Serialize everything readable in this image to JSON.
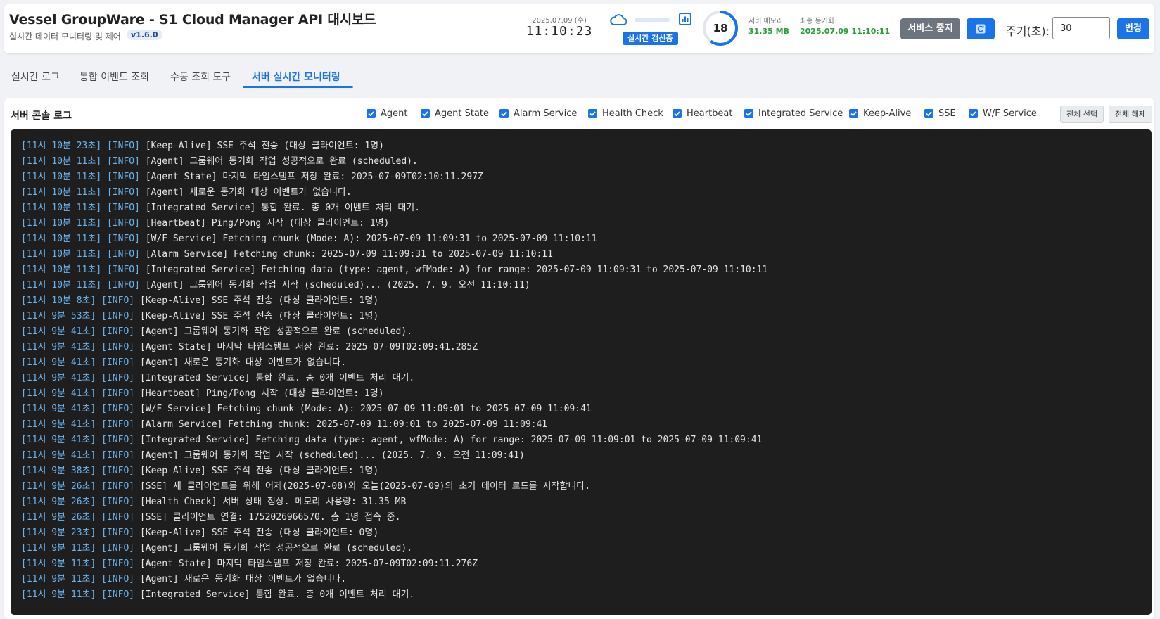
{
  "header": {
    "title": "Vessel GroupWare - S1 Cloud Manager API 대시보드",
    "subtitle": "실시간 데이터 모니터링 및 제어",
    "version": "v1.6.0",
    "date": "2025.07.09 (수)",
    "time": "11:10:23",
    "realtime_badge": "실시간 갱신중",
    "countdown": "18",
    "countdown_fraction": 0.6,
    "memory_label": "서버 메모리:",
    "memory_value": "31.35 MB",
    "sync_label": "최종 동기화:",
    "sync_value": "2025.07.09 11:10:11",
    "stop_button": "서비스 중지",
    "interval_label": "주기(초):",
    "interval_value": "30",
    "change_button": "변경",
    "progress_fraction": 0.0
  },
  "tabs": [
    {
      "label": "실시간 로그",
      "active": false
    },
    {
      "label": "통합 이벤트 조회",
      "active": false
    },
    {
      "label": "수동 조회 도구",
      "active": false
    },
    {
      "label": "서버 실시간 모니터링",
      "active": true
    }
  ],
  "panel": {
    "title": "서버 콘솔 로그",
    "filters": [
      {
        "label": "Agent",
        "checked": true
      },
      {
        "label": "Agent State",
        "checked": true
      },
      {
        "label": "Alarm Service",
        "checked": true
      },
      {
        "label": "Health Check",
        "checked": true
      },
      {
        "label": "Heartbeat",
        "checked": true
      },
      {
        "label": "Integrated Service",
        "checked": true
      },
      {
        "label": "Keep-Alive",
        "checked": true
      },
      {
        "label": "SSE",
        "checked": true
      },
      {
        "label": "W/F Service",
        "checked": true
      }
    ],
    "select_all": "전체 선택",
    "deselect_all": "전체 해제"
  },
  "logs": [
    {
      "ts": "[11시 10분 23초]",
      "level": "[INFO]",
      "msg": "[Keep-Alive] SSE 주석 전송 (대상 클라이언트: 1명)"
    },
    {
      "ts": "[11시 10분 11초]",
      "level": "[INFO]",
      "msg": "[Agent] 그룹웨어 동기화 작업 성공적으로 완료 (scheduled)."
    },
    {
      "ts": "[11시 10분 11초]",
      "level": "[INFO]",
      "msg": "[Agent State] 마지막 타임스탬프 저장 완료: 2025-07-09T02:10:11.297Z"
    },
    {
      "ts": "[11시 10분 11초]",
      "level": "[INFO]",
      "msg": "[Agent] 새로운 동기화 대상 이벤트가 없습니다."
    },
    {
      "ts": "[11시 10분 11초]",
      "level": "[INFO]",
      "msg": "[Integrated Service] 통합 완료. 총 0개 이벤트 처리 대기."
    },
    {
      "ts": "[11시 10분 11초]",
      "level": "[INFO]",
      "msg": "[Heartbeat] Ping/Pong 시작 (대상 클라이언트: 1명)"
    },
    {
      "ts": "[11시 10분 11초]",
      "level": "[INFO]",
      "msg": "[W/F Service] Fetching chunk (Mode: A): 2025-07-09 11:09:31 to 2025-07-09 11:10:11"
    },
    {
      "ts": "[11시 10분 11초]",
      "level": "[INFO]",
      "msg": "[Alarm Service] Fetching chunk: 2025-07-09 11:09:31 to 2025-07-09 11:10:11"
    },
    {
      "ts": "[11시 10분 11초]",
      "level": "[INFO]",
      "msg": "[Integrated Service] Fetching data (type: agent, wfMode: A) for range: 2025-07-09 11:09:31 to 2025-07-09 11:10:11"
    },
    {
      "ts": "[11시 10분 11초]",
      "level": "[INFO]",
      "msg": "[Agent] 그룹웨어 동기화 작업 시작 (scheduled)... (2025. 7. 9. 오전 11:10:11)"
    },
    {
      "ts": "[11시 10분 8초]",
      "level": "[INFO]",
      "msg": "[Keep-Alive] SSE 주석 전송 (대상 클라이언트: 1명)"
    },
    {
      "ts": "[11시 9분 53초]",
      "level": "[INFO]",
      "msg": "[Keep-Alive] SSE 주석 전송 (대상 클라이언트: 1명)"
    },
    {
      "ts": "[11시 9분 41초]",
      "level": "[INFO]",
      "msg": "[Agent] 그룹웨어 동기화 작업 성공적으로 완료 (scheduled)."
    },
    {
      "ts": "[11시 9분 41초]",
      "level": "[INFO]",
      "msg": "[Agent State] 마지막 타임스탬프 저장 완료: 2025-07-09T02:09:41.285Z"
    },
    {
      "ts": "[11시 9분 41초]",
      "level": "[INFO]",
      "msg": "[Agent] 새로운 동기화 대상 이벤트가 없습니다."
    },
    {
      "ts": "[11시 9분 41초]",
      "level": "[INFO]",
      "msg": "[Integrated Service] 통합 완료. 총 0개 이벤트 처리 대기."
    },
    {
      "ts": "[11시 9분 41초]",
      "level": "[INFO]",
      "msg": "[Heartbeat] Ping/Pong 시작 (대상 클라이언트: 1명)"
    },
    {
      "ts": "[11시 9분 41초]",
      "level": "[INFO]",
      "msg": "[W/F Service] Fetching chunk (Mode: A): 2025-07-09 11:09:01 to 2025-07-09 11:09:41"
    },
    {
      "ts": "[11시 9분 41초]",
      "level": "[INFO]",
      "msg": "[Alarm Service] Fetching chunk: 2025-07-09 11:09:01 to 2025-07-09 11:09:41"
    },
    {
      "ts": "[11시 9분 41초]",
      "level": "[INFO]",
      "msg": "[Integrated Service] Fetching data (type: agent, wfMode: A) for range: 2025-07-09 11:09:01 to 2025-07-09 11:09:41"
    },
    {
      "ts": "[11시 9분 41초]",
      "level": "[INFO]",
      "msg": "[Agent] 그룹웨어 동기화 작업 시작 (scheduled)... (2025. 7. 9. 오전 11:09:41)"
    },
    {
      "ts": "[11시 9분 38초]",
      "level": "[INFO]",
      "msg": "[Keep-Alive] SSE 주석 전송 (대상 클라이언트: 1명)"
    },
    {
      "ts": "[11시 9분 26초]",
      "level": "[INFO]",
      "msg": "[SSE] 새 클라이언트를 위해 어제(2025-07-08)와 오늘(2025-07-09)의 초기 데이터 로드를 시작합니다."
    },
    {
      "ts": "[11시 9분 26초]",
      "level": "[INFO]",
      "msg": "[Health Check] 서버 상태 정상. 메모리 사용량: 31.35 MB"
    },
    {
      "ts": "[11시 9분 26초]",
      "level": "[INFO]",
      "msg": "[SSE] 클라이언트 연결: 1752026966570. 총 1명 접속 중."
    },
    {
      "ts": "[11시 9분 23초]",
      "level": "[INFO]",
      "msg": "[Keep-Alive] SSE 주석 전송 (대상 클라이언트: 0명)"
    },
    {
      "ts": "[11시 9분 11초]",
      "level": "[INFO]",
      "msg": "[Agent] 그룹웨어 동기화 작업 성공적으로 완료 (scheduled)."
    },
    {
      "ts": "[11시 9분 11초]",
      "level": "[INFO]",
      "msg": "[Agent State] 마지막 타임스탬프 저장 완료: 2025-07-09T02:09:11.276Z"
    },
    {
      "ts": "[11시 9분 11초]",
      "level": "[INFO]",
      "msg": "[Agent] 새로운 동기화 대상 이벤트가 없습니다."
    },
    {
      "ts": "[11시 9분 11초]",
      "level": "[INFO]",
      "msg": "[Integrated Service] 통합 완료. 총 0개 이벤트 처리 대기."
    }
  ],
  "colors": {
    "accent": "#1a73e8",
    "success": "#2e9b3f",
    "console_bg": "#1e1e1e",
    "log_timestamp": "#6cb4ee"
  }
}
